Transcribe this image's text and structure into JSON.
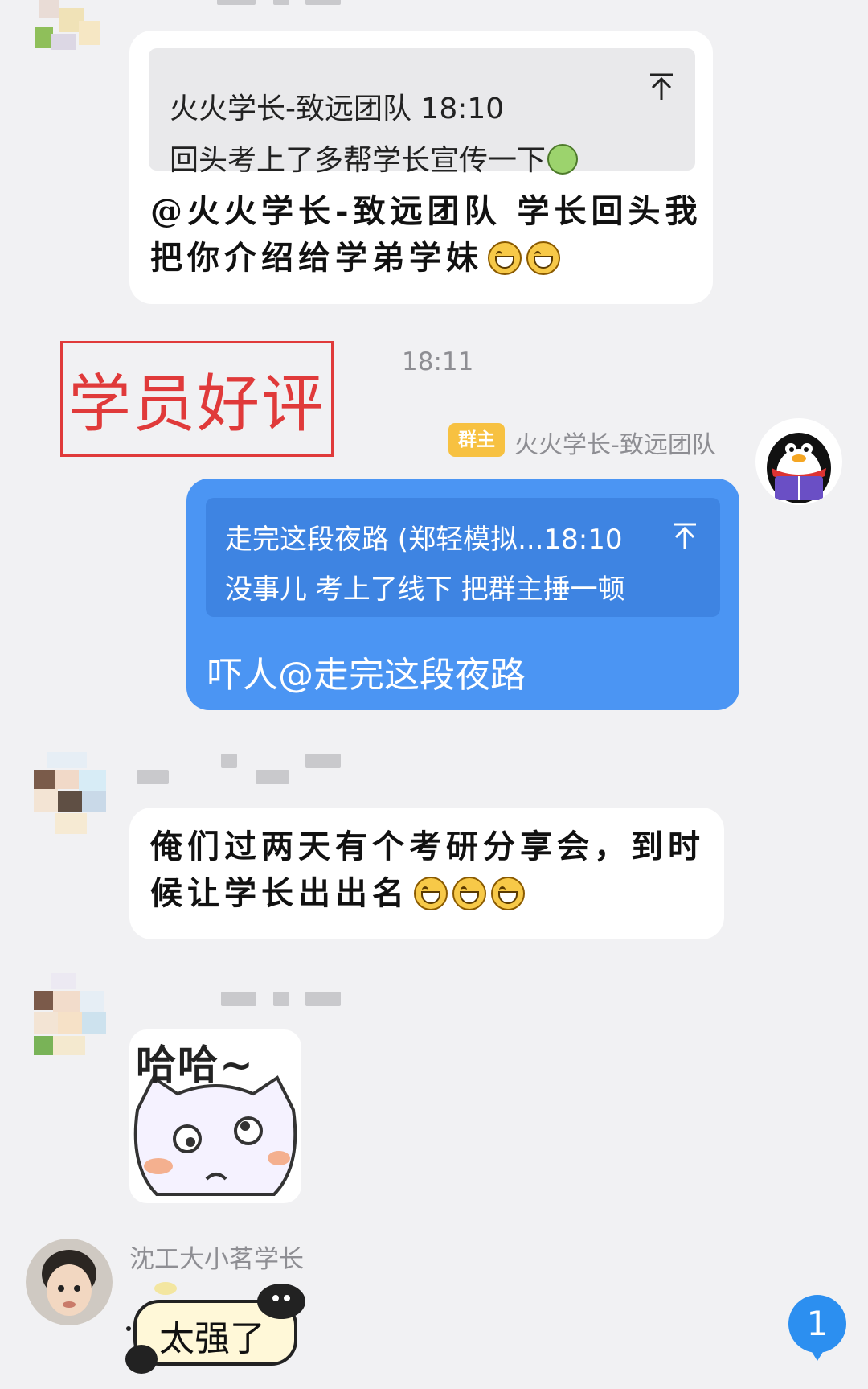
{
  "messages": {
    "m1": {
      "quote_author_time": "火火学长-致远团队 18:10",
      "quote_text": "回头考上了多帮学长宣传一下",
      "text_line1": "@火火学长-致远团队 学长回头我",
      "text_line2": "把你介绍给学弟学妹"
    },
    "stamp": {
      "label": "学员好评"
    },
    "time_divider": "18:11",
    "m2": {
      "badge": "群主",
      "sender": "火火学长-致远团队",
      "quote_author_time": "走完这段夜路 (郑轻模拟...18:10",
      "quote_text": "没事儿 考上了线下 把群主捶一顿",
      "text": "吓人@走完这段夜路"
    },
    "m3": {
      "text_line1": "俺们过两天有个考研分享会，到时",
      "text_line2": "候让学长出出名"
    },
    "m4": {
      "sticker_text": "哈哈~"
    },
    "m5": {
      "sender": "沈工大小茗学长",
      "sticker_text": "太强了"
    }
  },
  "unread_badge": {
    "count": "1"
  },
  "colors": {
    "background": "#f1f1f3",
    "self_bubble": "#4b95f3",
    "self_quote": "#3e84e2",
    "badge_yellow": "#f7c141",
    "stamp_red": "#e03a3a",
    "unread_blue": "#2c8ff0"
  },
  "icons": [
    "pin-to-top-icon",
    "grin-emoji-icon",
    "green-sticker-emoji-icon",
    "penguin-avatar-icon"
  ]
}
